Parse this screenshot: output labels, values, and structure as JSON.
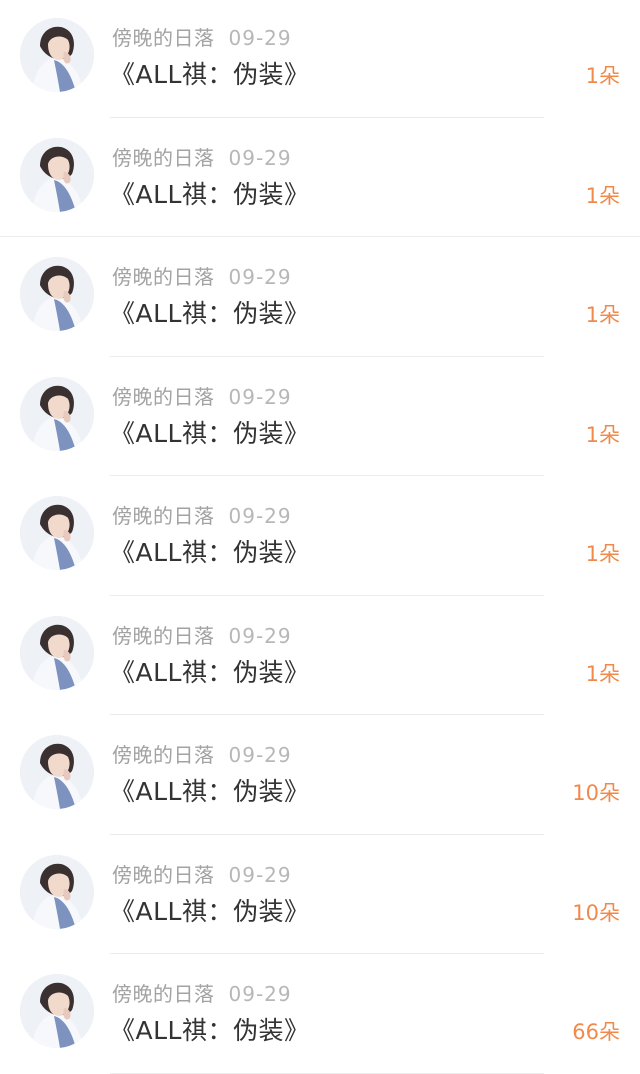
{
  "items": [
    {
      "user": "傍晚的日落",
      "date": "09-29",
      "title": "《ALL祺：伪装》",
      "count": "1朵"
    },
    {
      "user": "傍晚的日落",
      "date": "09-29",
      "title": "《ALL祺：伪装》",
      "count": "1朵"
    },
    {
      "user": "傍晚的日落",
      "date": "09-29",
      "title": "《ALL祺：伪装》",
      "count": "1朵"
    },
    {
      "user": "傍晚的日落",
      "date": "09-29",
      "title": "《ALL祺：伪装》",
      "count": "1朵"
    },
    {
      "user": "傍晚的日落",
      "date": "09-29",
      "title": "《ALL祺：伪装》",
      "count": "1朵"
    },
    {
      "user": "傍晚的日落",
      "date": "09-29",
      "title": "《ALL祺：伪装》",
      "count": "1朵"
    },
    {
      "user": "傍晚的日落",
      "date": "09-29",
      "title": "《ALL祺：伪装》",
      "count": "10朵"
    },
    {
      "user": "傍晚的日落",
      "date": "09-29",
      "title": "《ALL祺：伪装》",
      "count": "10朵"
    },
    {
      "user": "傍晚的日落",
      "date": "09-29",
      "title": "《ALL祺：伪装》",
      "count": "66朵"
    }
  ],
  "colors": {
    "accent": "#f08a4b",
    "username": "#a3a3a3",
    "title": "#333333",
    "divider": "#ececec"
  }
}
